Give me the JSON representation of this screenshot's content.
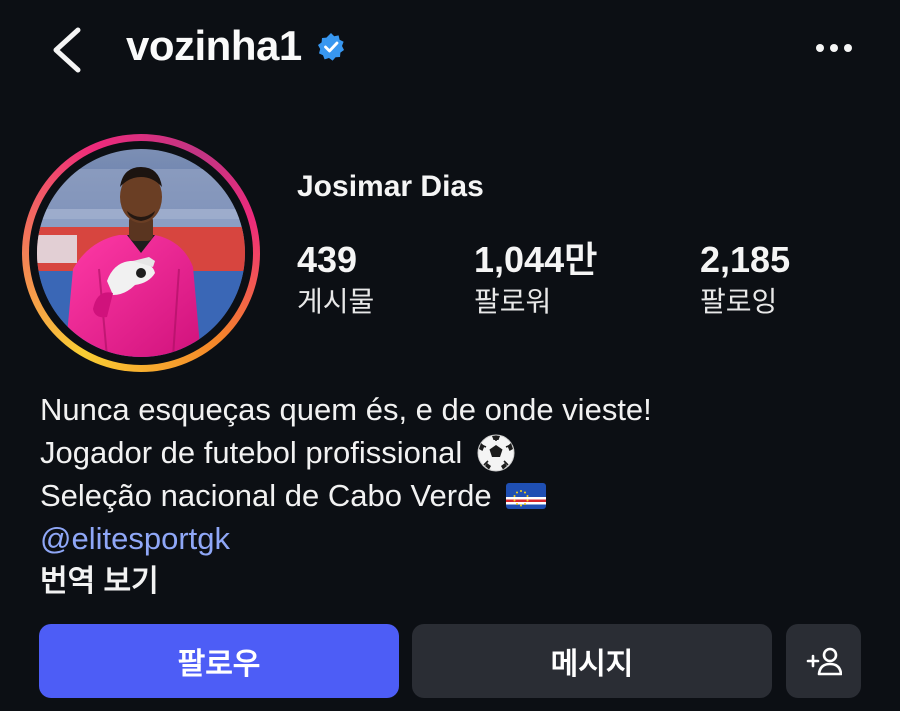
{
  "header": {
    "username": "vozinha1",
    "back_icon": "chevron-left-icon",
    "verified_icon": "verified-badge-icon",
    "more_icon": "more-horizontal-icon"
  },
  "profile": {
    "display_name": "Josimar Dias",
    "stats": [
      {
        "value": "439",
        "label": "게시물"
      },
      {
        "value": "1,044만",
        "label": "팔로워"
      },
      {
        "value": "2,185",
        "label": "팔로잉"
      }
    ],
    "bio": {
      "line1": "Nunca esqueças quem és, e de onde vieste!",
      "line2": "Jogador de futebol profissional",
      "line3": "Seleção nacional de Cabo Verde",
      "link": "@elitesportgk",
      "translate": "번역 보기"
    }
  },
  "actions": {
    "follow_label": "팔로우",
    "message_label": "메시지",
    "add_icon": "add-person-icon"
  },
  "colors": {
    "background": "#0c0f14",
    "accent": "#4d5df6",
    "secondary_button": "#2a2d34",
    "link": "#8fa7f7",
    "verified": "#3897f0"
  }
}
